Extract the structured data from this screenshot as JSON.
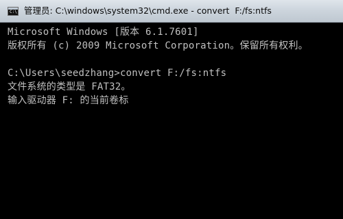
{
  "window": {
    "title": "管理员: C:\\windows\\system32\\cmd.exe - convert  F:/fs:ntfs",
    "icon": "cmd-icon",
    "icon_glyph": "C:\\"
  },
  "console": {
    "lines": [
      "Microsoft Windows [版本 6.1.7601]",
      "版权所有 (c) 2009 Microsoft Corporation。保留所有权利。",
      "",
      "C:\\Users\\seedzhang>convert F:/fs:ntfs",
      "文件系统的类型是 FAT32。",
      "输入驱动器 F: 的当前卷标"
    ]
  },
  "colors": {
    "console_bg": "#000000",
    "console_text": "#c0c0c0",
    "titlebar": "#cdd5dd"
  }
}
